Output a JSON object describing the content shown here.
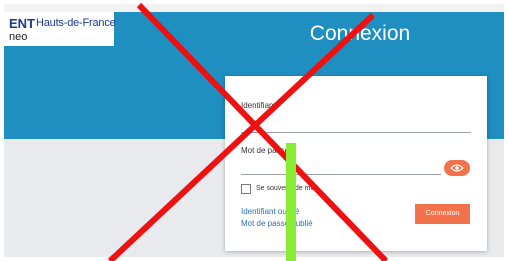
{
  "header": {
    "logo": {
      "ent": "ENT",
      "region": "Hauts-de-France",
      "product": "neo"
    },
    "title": "Connexion"
  },
  "form": {
    "identifier_label": "Identifiant",
    "password_label": "Mot de passe",
    "remember_label": "Se souvenir de moi",
    "forgot_identifier_link": "Identifiant oublié",
    "forgot_password_link": "Mot de passe oublié",
    "submit_label": "Connexion"
  },
  "colors": {
    "banner": "#1f8ec0",
    "accent": "#f2734b",
    "overlay_cross": "#ee1111",
    "overlay_bar": "#88ee33"
  },
  "icons": {
    "password_toggle": "eye-icon"
  }
}
